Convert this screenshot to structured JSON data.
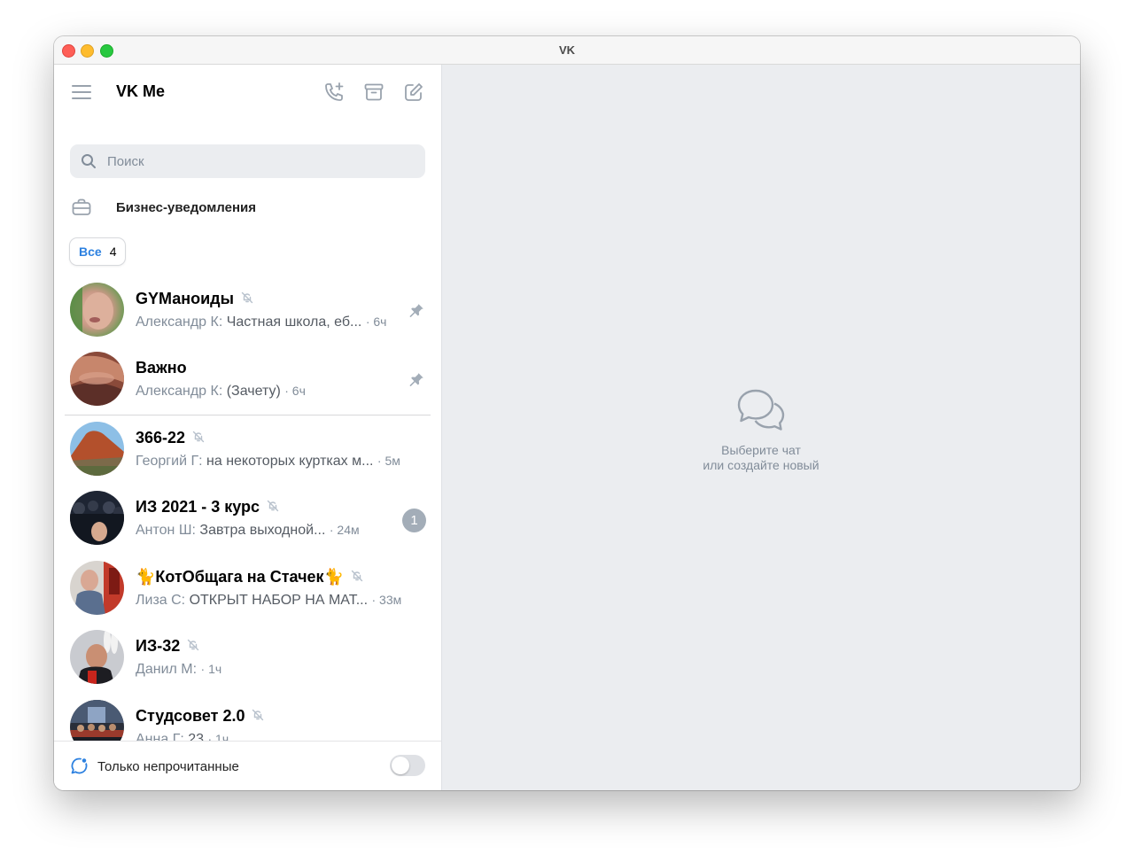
{
  "window": {
    "title": "VK"
  },
  "header": {
    "app_title": "VK Me"
  },
  "search": {
    "placeholder": "Поиск",
    "value": ""
  },
  "business": {
    "label": "Бизнес-уведомления"
  },
  "filter": {
    "label": "Все",
    "count": "4"
  },
  "chats": [
    {
      "title": "GYМаноиды",
      "author": "Александр К:",
      "message": "Частная школа, еб...",
      "time": "· 6ч",
      "muted": true,
      "pinned": true,
      "unread": null
    },
    {
      "title": "Важно",
      "author": "Александр К:",
      "message": "(Зачету)",
      "time": "· 6ч",
      "muted": false,
      "pinned": true,
      "unread": null
    },
    {
      "title": "366-22",
      "author": "Георгий Г:",
      "message": "на некоторых куртках м...",
      "time": "· 5м",
      "muted": true,
      "pinned": false,
      "unread": null
    },
    {
      "title": "ИЗ 2021 - 3 курс",
      "author": "Антон Ш:",
      "message": "Завтра выходной...",
      "time": "· 24м",
      "muted": true,
      "pinned": false,
      "unread": "1"
    },
    {
      "title": "🐈КотОбщага на Стачек🐈",
      "author": "Лиза С:",
      "message": "ОТКРЫТ НАБОР НА МАТ...",
      "time": "· 33м",
      "muted": true,
      "pinned": false,
      "unread": null
    },
    {
      "title": "ИЗ-32",
      "author": "Данил М:",
      "message": "",
      "time": "· 1ч",
      "muted": true,
      "pinned": false,
      "unread": null
    },
    {
      "title": "Студсовет 2.0",
      "author": "Анна Г:",
      "message": "23",
      "time": "· 1ч",
      "muted": true,
      "pinned": false,
      "unread": null
    }
  ],
  "footer": {
    "unread_only_label": "Только непрочитанные",
    "unread_only_enabled": false
  },
  "empty_state": {
    "line1": "Выберите чат",
    "line2": "или создайте новый"
  },
  "icons": {
    "menu": "hamburger-icon",
    "call": "add-call-icon",
    "archive": "archive-icon",
    "compose": "compose-icon",
    "search": "search-icon",
    "business": "briefcase-icon",
    "mute": "muted-bell-icon",
    "pin": "pin-icon",
    "unread_filter": "chat-bubble-icon",
    "empty_chat": "chat-bubbles-icon"
  },
  "colors": {
    "accent": "#2d81e0",
    "muted_text": "#818c99",
    "main_bg": "#ebedf0",
    "badge": "#a3adb8"
  }
}
